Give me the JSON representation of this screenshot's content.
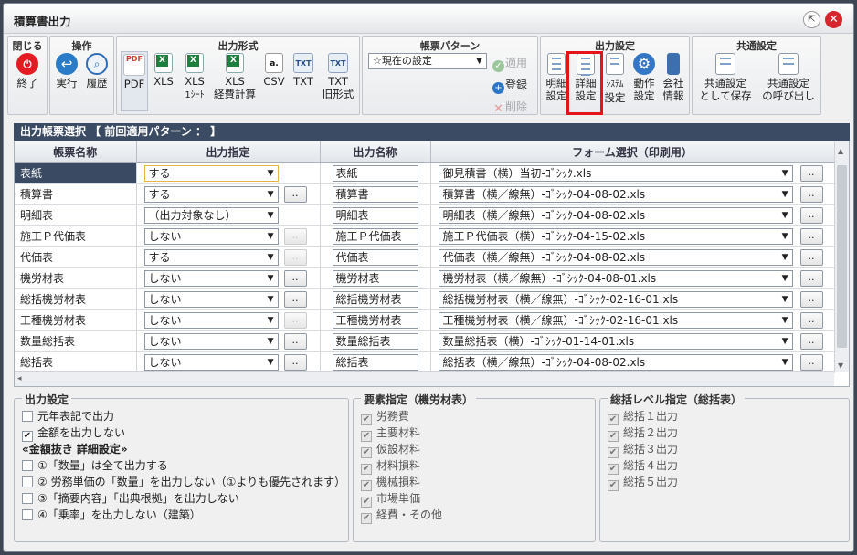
{
  "window": {
    "title": "積算書出力",
    "popout_icon": "⇱",
    "close_icon": "✕"
  },
  "ribbon": {
    "groups": {
      "close": "閉じる",
      "operation": "操作",
      "format": "出力形式",
      "pattern": "帳票パターン",
      "settings": "出力設定",
      "common": "共通設定"
    },
    "close_btn": "終了",
    "run_btn": "実行",
    "history_btn": "履歴",
    "formats": {
      "pdf": "PDF",
      "xls": "XLS",
      "xls1a": "XLS",
      "xls1b": "1ｼｰﾄ",
      "xlsk_a": "XLS",
      "xlsk_b": "経費計算",
      "csv": "CSV",
      "txt": "TXT",
      "txt_old_a": "TXT",
      "txt_old_b": "旧形式"
    },
    "pattern": {
      "selected": "☆現在の設定",
      "apply": "適用",
      "register": "登録",
      "delete": "削除"
    },
    "settings": {
      "detail_a": "明細",
      "detail_b": "設定",
      "adv_a": "詳細",
      "adv_b": "設定",
      "sys_a": "ｼｽﾃﾑ",
      "sys_b": "設定",
      "act_a": "動作",
      "act_b": "設定",
      "co_a": "会社",
      "co_b": "情報"
    },
    "common": {
      "save_a": "共通設定",
      "save_b": "として保存",
      "load_a": "共通設定",
      "load_b": "の呼び出し"
    }
  },
  "section_title": "出力帳票選択 【 前回適用パターン ： 】",
  "table": {
    "headers": [
      "帳票名称",
      "出力指定",
      "出力名称",
      "フォーム選択（印刷用）"
    ],
    "rows": [
      {
        "name": "表紙",
        "output": "する",
        "outname": "表紙",
        "form": "御見積書（横）当初-ｺﾞｼｯｸ.xls"
      },
      {
        "name": "積算書",
        "output": "する",
        "outname": "積算書",
        "form": "積算書（横／線無）-ｺﾞｼｯｸ-04-08-02.xls"
      },
      {
        "name": "明細表",
        "output": "（出力対象なし）",
        "outname": "明細表",
        "form": "明細表（横／線無）-ｺﾞｼｯｸ-04-08-02.xls"
      },
      {
        "name": "施工Ｐ代価表",
        "output": "しない",
        "outname": "施工Ｐ代価表",
        "form": "施工Ｐ代価表（横）-ｺﾞｼｯｸ-04-15-02.xls"
      },
      {
        "name": "代価表",
        "output": "する",
        "outname": "代価表",
        "form": "代価表（横／線無）-ｺﾞｼｯｸ-04-08-02.xls"
      },
      {
        "name": "機労材表",
        "output": "しない",
        "outname": "機労材表",
        "form": "機労材表（横／線無）-ｺﾞｼｯｸ-04-08-01.xls"
      },
      {
        "name": "総括機労材表",
        "output": "しない",
        "outname": "総括機労材表",
        "form": "総括機労材表（横／線無）-ｺﾞｼｯｸ-02-16-01.xls"
      },
      {
        "name": "工種機労材表",
        "output": "しない",
        "outname": "工種機労材表",
        "form": "工種機労材表（横／線無）-ｺﾞｼｯｸ-02-16-01.xls"
      },
      {
        "name": "数量総括表",
        "output": "しない",
        "outname": "数量総括表",
        "form": "数量総括表（横）-ｺﾞｼｯｸ-01-14-01.xls"
      },
      {
        "name": "総括表",
        "output": "しない",
        "outname": "総括表",
        "form": "総括表（横／線無）-ｺﾞｼｯｸ-04-08-02.xls"
      }
    ],
    "dots_label": "..",
    "dropdown_arrow": "▼",
    "hscroll_arrow": "◂",
    "vscroll_up": "▲",
    "vscroll_down": "▼"
  },
  "output_settings": {
    "title": "出力設定",
    "items": [
      {
        "label": "元年表記で出力",
        "checked": false
      },
      {
        "label": "金額を出力しない",
        "checked": true
      }
    ],
    "sub_title": "«金額抜き 詳細設定»",
    "sub_items": [
      {
        "label": "①「数量」は全て出力する",
        "checked": false
      },
      {
        "label": "② 労務単価の「数量」を出力しない（①よりも優先されます）",
        "checked": false
      },
      {
        "label": "③「摘要内容」「出典根拠」を出力しない",
        "checked": false
      },
      {
        "label": "④「乗率」を出力しない（建築）",
        "checked": false
      }
    ]
  },
  "element_settings": {
    "title": "要素指定（機労材表）",
    "items": [
      "労務費",
      "主要材料",
      "仮設材料",
      "材料損料",
      "機械損料",
      "市場単価",
      "経費・その他"
    ]
  },
  "level_settings": {
    "title": "総括レベル指定（総括表）",
    "items": [
      "総括１出力",
      "総括２出力",
      "総括３出力",
      "総括４出力",
      "総括５出力"
    ]
  },
  "check_mark": "✔"
}
